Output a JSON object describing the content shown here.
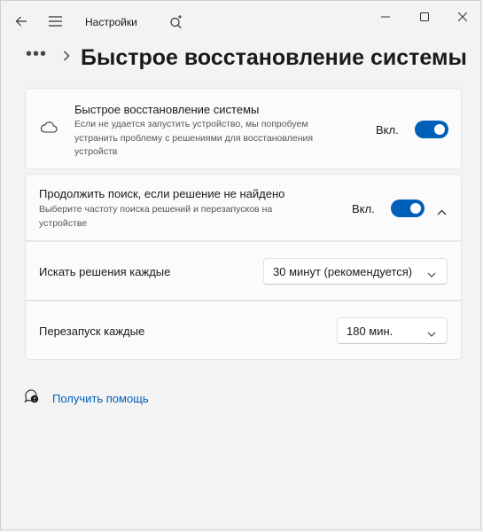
{
  "titlebar": {
    "app_title": "Настройки",
    "icons": [
      "back-arrow-icon",
      "hamburger-menu-icon",
      "search-sparkle-icon"
    ],
    "window_controls": [
      "minimize-icon",
      "maximize-icon",
      "close-icon"
    ]
  },
  "header": {
    "breadcrumb_overflow": "•••",
    "title": "Быстрое восстановление системы"
  },
  "quick_recovery": {
    "title": "Быстрое восстановление системы",
    "description": "Если не удается запустить устройство, мы попробуем устранить проблему с решениями для восстановления устройств",
    "state_label": "Вкл.",
    "enabled": true,
    "icon": "cloud-icon"
  },
  "continue_search": {
    "title": "Продолжить поиск, если решение не найдено",
    "description": "Выберите частоту поиска решений и перезапусков на устройстве",
    "state_label": "Вкл.",
    "enabled": true,
    "expanded": true
  },
  "search_interval": {
    "label": "Искать решения каждые",
    "selected": "30 минут (рекомендуется)"
  },
  "restart_interval": {
    "label": "Перезапуск каждые",
    "selected": "180 мин."
  },
  "help": {
    "link_label": "Получить помощь",
    "icon": "help-chat-icon"
  },
  "colors": {
    "accent": "#005fb8",
    "background": "#f3f3f3",
    "card": "#fbfbfb"
  }
}
